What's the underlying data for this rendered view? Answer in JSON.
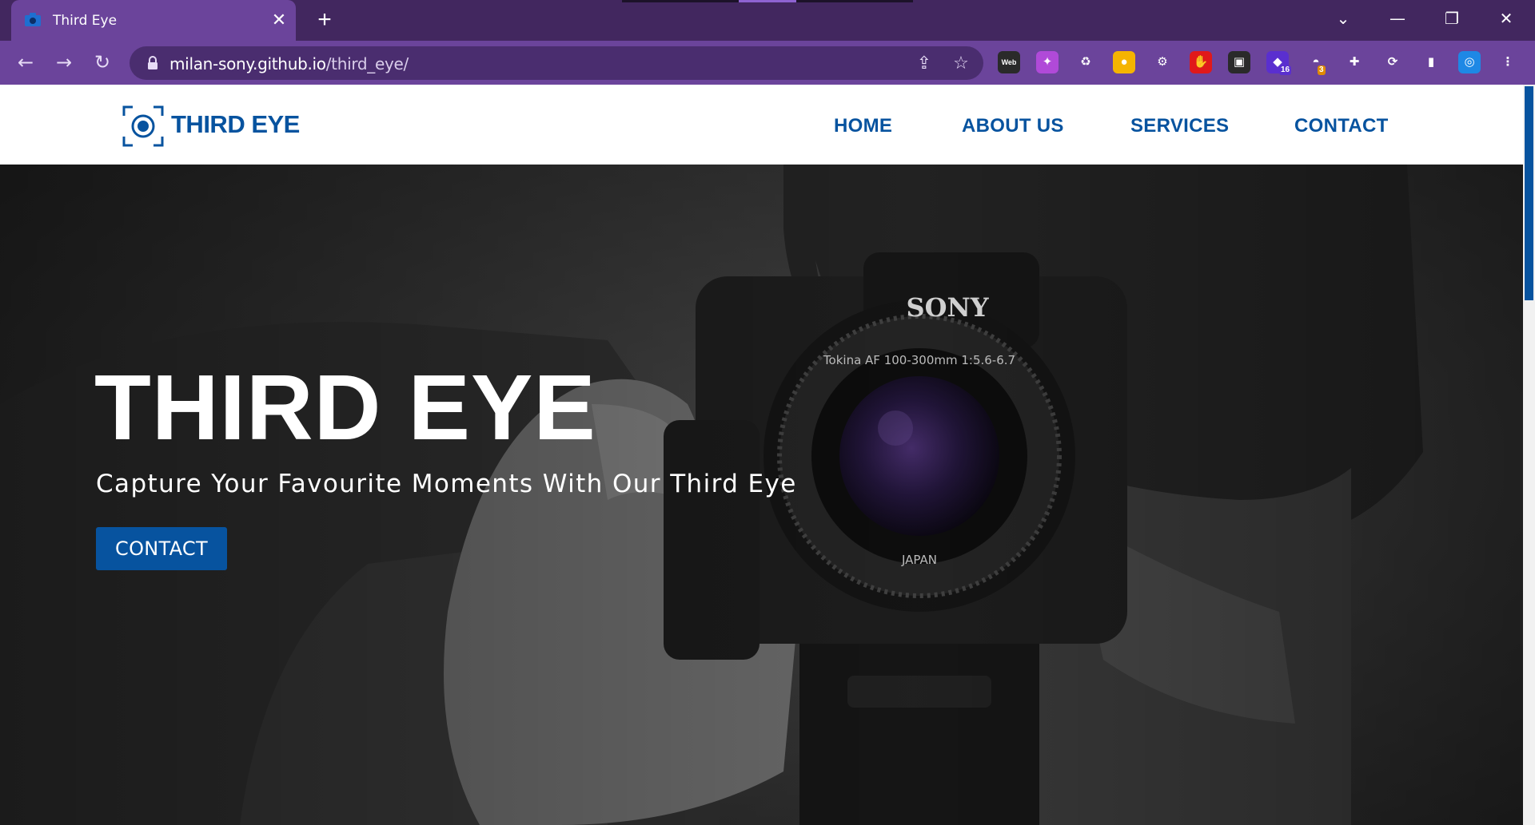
{
  "browser": {
    "tab_title": "Third Eye",
    "tab_close": "✕",
    "new_tab": "+",
    "url_host": "milan-sony.github.io",
    "url_path": "/third_eye/",
    "window_controls": {
      "minimize": "—",
      "restore": "❐",
      "close": "✕",
      "tab_search": "⌄"
    },
    "nav": {
      "back": "←",
      "forward": "→",
      "reload": "↻"
    },
    "omnibox_icons": {
      "share": "⇪",
      "bookmark": "☆"
    },
    "extensions": [
      {
        "name": "web-developer-extension-icon",
        "label": "Web",
        "color": "#2a2a2a"
      },
      {
        "name": "sparkle-extension-icon",
        "label": "✦",
        "color": "#b04ad8"
      },
      {
        "name": "recycle-extension-icon",
        "label": "♻",
        "color": "#6b449b"
      },
      {
        "name": "bulb-extension-icon",
        "label": "●",
        "color": "#f5b400"
      },
      {
        "name": "gear-extension-icon",
        "label": "⚙",
        "color": "#6b449b"
      },
      {
        "name": "stop-hand-extension-icon",
        "label": "✋",
        "color": "#e0191a"
      },
      {
        "name": "picture-in-picture-extension-icon",
        "label": "▣",
        "color": "#2a2a2a"
      },
      {
        "name": "gem-extension-icon",
        "label": "◆",
        "color": "#5a2fcf",
        "badge": "16"
      },
      {
        "name": "ufo-extension-icon",
        "label": "◓",
        "color": "#6b449b",
        "badge": "3"
      },
      {
        "name": "puzzle-extension-icon",
        "label": "✚",
        "color": "#6b449b"
      },
      {
        "name": "refresh-bolt-extension-icon",
        "label": "⟳",
        "color": "#6b449b"
      },
      {
        "name": "sidebar-extension-icon",
        "label": "▮",
        "color": "#6b449b"
      },
      {
        "name": "target-extension-icon",
        "label": "◎",
        "color": "#1e88e5"
      },
      {
        "name": "menu-kebab-icon",
        "label": "⋮",
        "color": "#6b449b"
      }
    ]
  },
  "site": {
    "brand": "THIRD EYE",
    "nav": [
      "HOME",
      "ABOUT US",
      "SERVICES",
      "CONTACT"
    ],
    "hero": {
      "title": "THIRD EYE",
      "subtitle": "Capture Your Favourite Moments With Our Third Eye",
      "button": "CONTACT"
    },
    "photo_text": {
      "camera_brand": "SONY",
      "lens_text": "Tokina AF 100-300mm 1:5.6-6.7",
      "lens_origin": "JAPAN"
    }
  },
  "colors": {
    "brand_blue": "#07539f",
    "tab_purple": "#6b449b",
    "tabbar_purple": "#42275f"
  }
}
